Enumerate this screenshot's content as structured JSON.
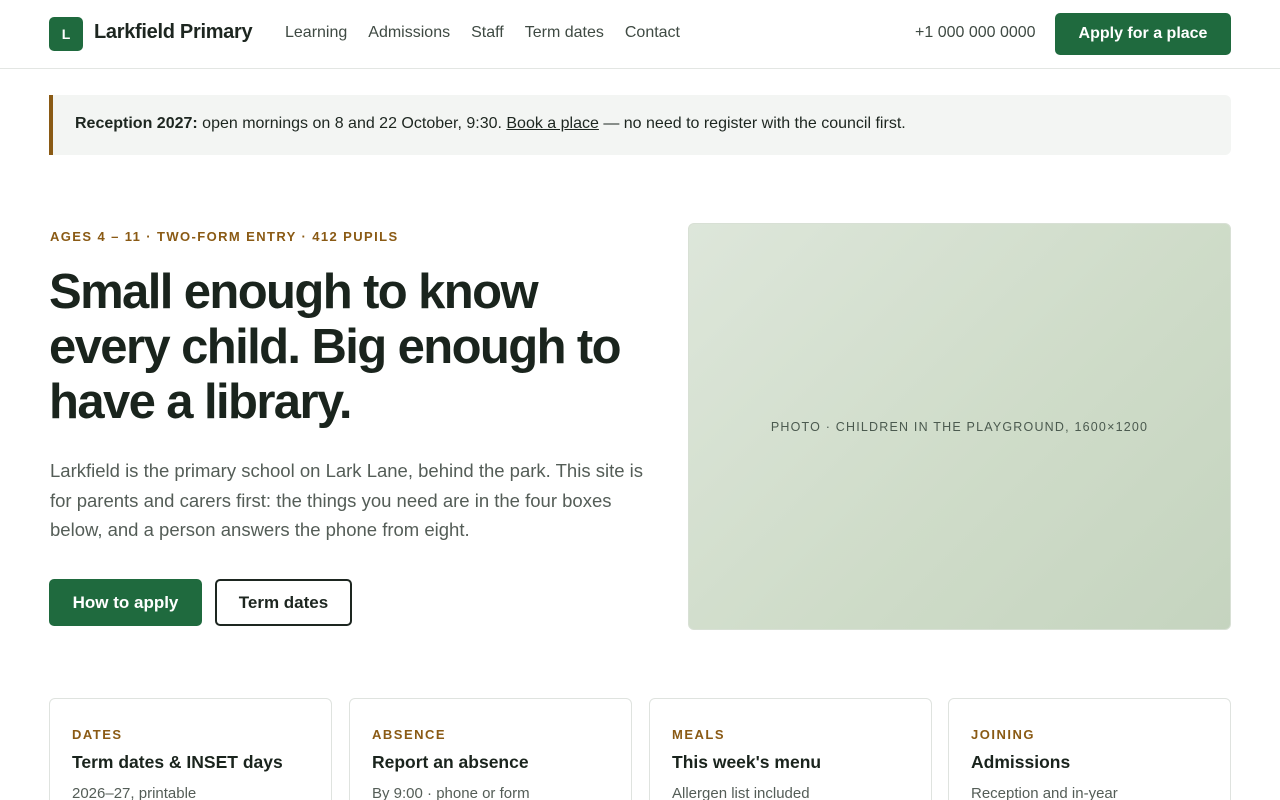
{
  "header": {
    "logo_letter": "L",
    "brand": "Larkfield Primary",
    "nav": [
      "Learning",
      "Admissions",
      "Staff",
      "Term dates",
      "Contact"
    ],
    "phone": "+1 000 000 0000",
    "apply_label": "Apply for a place"
  },
  "notice": {
    "bold": "Reception 2027:",
    "text_before": " open mornings on 8 and 22 October, 9:30. ",
    "link": "Book a place",
    "text_after": " — no need to register with the council first."
  },
  "hero": {
    "eyebrow": "AGES 4 – 11 · TWO-FORM ENTRY · 412 PUPILS",
    "title": "Small enough to know every child. Big enough to have a library.",
    "body": "Larkfield is the primary school on Lark Lane, behind the park. This site is for parents and carers first: the things you need are in the four boxes below, and a person answers the phone from eight.",
    "primary_cta": "How to apply",
    "secondary_cta": "Term dates",
    "photo_caption": "PHOTO · CHILDREN IN THE PLAYGROUND, 1600×1200"
  },
  "cards": [
    {
      "eyebrow": "DATES",
      "title": "Term dates & INSET days",
      "sub": "2026–27, printable"
    },
    {
      "eyebrow": "ABSENCE",
      "title": "Report an absence",
      "sub": "By 9:00 · phone or form"
    },
    {
      "eyebrow": "MEALS",
      "title": "This week's menu",
      "sub": "Allergen list included"
    },
    {
      "eyebrow": "JOINING",
      "title": "Admissions",
      "sub": "Reception and in-year"
    }
  ],
  "colors": {
    "brand_green": "#1f6a3e",
    "accent_brown": "#8a5a14",
    "text_dark": "#1a241d"
  }
}
